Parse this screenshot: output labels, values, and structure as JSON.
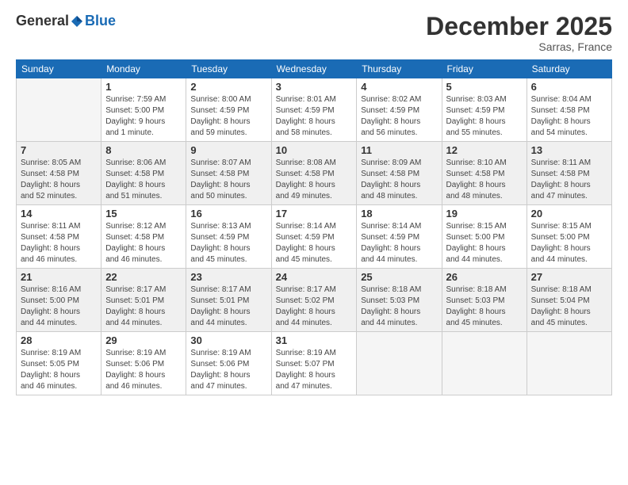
{
  "logo": {
    "general": "General",
    "blue": "Blue"
  },
  "title": "December 2025",
  "subtitle": "Sarras, France",
  "days_of_week": [
    "Sunday",
    "Monday",
    "Tuesday",
    "Wednesday",
    "Thursday",
    "Friday",
    "Saturday"
  ],
  "weeks": [
    [
      {
        "day": "",
        "info": ""
      },
      {
        "day": "1",
        "info": "Sunrise: 7:59 AM\nSunset: 5:00 PM\nDaylight: 9 hours\nand 1 minute."
      },
      {
        "day": "2",
        "info": "Sunrise: 8:00 AM\nSunset: 4:59 PM\nDaylight: 8 hours\nand 59 minutes."
      },
      {
        "day": "3",
        "info": "Sunrise: 8:01 AM\nSunset: 4:59 PM\nDaylight: 8 hours\nand 58 minutes."
      },
      {
        "day": "4",
        "info": "Sunrise: 8:02 AM\nSunset: 4:59 PM\nDaylight: 8 hours\nand 56 minutes."
      },
      {
        "day": "5",
        "info": "Sunrise: 8:03 AM\nSunset: 4:59 PM\nDaylight: 8 hours\nand 55 minutes."
      },
      {
        "day": "6",
        "info": "Sunrise: 8:04 AM\nSunset: 4:58 PM\nDaylight: 8 hours\nand 54 minutes."
      }
    ],
    [
      {
        "day": "7",
        "info": "Sunrise: 8:05 AM\nSunset: 4:58 PM\nDaylight: 8 hours\nand 52 minutes."
      },
      {
        "day": "8",
        "info": "Sunrise: 8:06 AM\nSunset: 4:58 PM\nDaylight: 8 hours\nand 51 minutes."
      },
      {
        "day": "9",
        "info": "Sunrise: 8:07 AM\nSunset: 4:58 PM\nDaylight: 8 hours\nand 50 minutes."
      },
      {
        "day": "10",
        "info": "Sunrise: 8:08 AM\nSunset: 4:58 PM\nDaylight: 8 hours\nand 49 minutes."
      },
      {
        "day": "11",
        "info": "Sunrise: 8:09 AM\nSunset: 4:58 PM\nDaylight: 8 hours\nand 48 minutes."
      },
      {
        "day": "12",
        "info": "Sunrise: 8:10 AM\nSunset: 4:58 PM\nDaylight: 8 hours\nand 48 minutes."
      },
      {
        "day": "13",
        "info": "Sunrise: 8:11 AM\nSunset: 4:58 PM\nDaylight: 8 hours\nand 47 minutes."
      }
    ],
    [
      {
        "day": "14",
        "info": "Sunrise: 8:11 AM\nSunset: 4:58 PM\nDaylight: 8 hours\nand 46 minutes."
      },
      {
        "day": "15",
        "info": "Sunrise: 8:12 AM\nSunset: 4:58 PM\nDaylight: 8 hours\nand 46 minutes."
      },
      {
        "day": "16",
        "info": "Sunrise: 8:13 AM\nSunset: 4:59 PM\nDaylight: 8 hours\nand 45 minutes."
      },
      {
        "day": "17",
        "info": "Sunrise: 8:14 AM\nSunset: 4:59 PM\nDaylight: 8 hours\nand 45 minutes."
      },
      {
        "day": "18",
        "info": "Sunrise: 8:14 AM\nSunset: 4:59 PM\nDaylight: 8 hours\nand 44 minutes."
      },
      {
        "day": "19",
        "info": "Sunrise: 8:15 AM\nSunset: 5:00 PM\nDaylight: 8 hours\nand 44 minutes."
      },
      {
        "day": "20",
        "info": "Sunrise: 8:15 AM\nSunset: 5:00 PM\nDaylight: 8 hours\nand 44 minutes."
      }
    ],
    [
      {
        "day": "21",
        "info": "Sunrise: 8:16 AM\nSunset: 5:00 PM\nDaylight: 8 hours\nand 44 minutes."
      },
      {
        "day": "22",
        "info": "Sunrise: 8:17 AM\nSunset: 5:01 PM\nDaylight: 8 hours\nand 44 minutes."
      },
      {
        "day": "23",
        "info": "Sunrise: 8:17 AM\nSunset: 5:01 PM\nDaylight: 8 hours\nand 44 minutes."
      },
      {
        "day": "24",
        "info": "Sunrise: 8:17 AM\nSunset: 5:02 PM\nDaylight: 8 hours\nand 44 minutes."
      },
      {
        "day": "25",
        "info": "Sunrise: 8:18 AM\nSunset: 5:03 PM\nDaylight: 8 hours\nand 44 minutes."
      },
      {
        "day": "26",
        "info": "Sunrise: 8:18 AM\nSunset: 5:03 PM\nDaylight: 8 hours\nand 45 minutes."
      },
      {
        "day": "27",
        "info": "Sunrise: 8:18 AM\nSunset: 5:04 PM\nDaylight: 8 hours\nand 45 minutes."
      }
    ],
    [
      {
        "day": "28",
        "info": "Sunrise: 8:19 AM\nSunset: 5:05 PM\nDaylight: 8 hours\nand 46 minutes."
      },
      {
        "day": "29",
        "info": "Sunrise: 8:19 AM\nSunset: 5:06 PM\nDaylight: 8 hours\nand 46 minutes."
      },
      {
        "day": "30",
        "info": "Sunrise: 8:19 AM\nSunset: 5:06 PM\nDaylight: 8 hours\nand 47 minutes."
      },
      {
        "day": "31",
        "info": "Sunrise: 8:19 AM\nSunset: 5:07 PM\nDaylight: 8 hours\nand 47 minutes."
      },
      {
        "day": "",
        "info": ""
      },
      {
        "day": "",
        "info": ""
      },
      {
        "day": "",
        "info": ""
      }
    ]
  ]
}
